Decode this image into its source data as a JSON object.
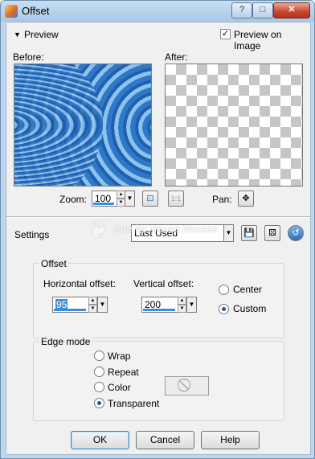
{
  "window": {
    "title": "Offset",
    "help_glyph": "?",
    "maximize_glyph": "□",
    "close_glyph": "✕"
  },
  "preview": {
    "section_label": "Preview",
    "preview_on_image_label": "Preview on Image",
    "preview_on_image_checked": true,
    "before_label": "Before:",
    "after_label": "After:",
    "zoom_label": "Zoom:",
    "zoom_value": "100",
    "pan_label": "Pan:",
    "one_to_one_label": "1:1"
  },
  "settings": {
    "label": "Settings",
    "preset_value": "Last Used"
  },
  "offset": {
    "group_label": "Offset",
    "horizontal_label": "Horizontal offset:",
    "horizontal_value": "95",
    "vertical_label": "Vertical offset:",
    "vertical_value": "200",
    "center_label": "Center",
    "custom_label": "Custom",
    "selected": "Custom"
  },
  "edge_mode": {
    "group_label": "Edge mode",
    "options": [
      "Wrap",
      "Repeat",
      "Color",
      "Transparent"
    ],
    "selected": "Transparent"
  },
  "buttons": {
    "ok": "OK",
    "cancel": "Cancel",
    "help": "Help"
  },
  "watermark": {
    "text": "Arte by Neusa Novaes"
  },
  "colors": {
    "accent": "#3b8edb",
    "title_bar": "#bfd7ee",
    "close": "#c8432b"
  }
}
